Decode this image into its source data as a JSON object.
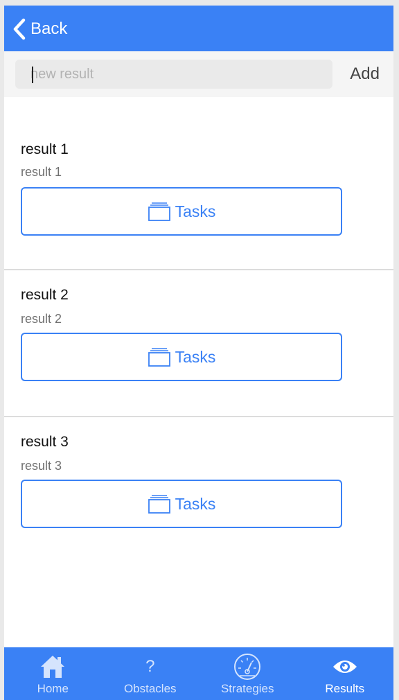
{
  "header": {
    "back_label": "Back"
  },
  "input_bar": {
    "placeholder": "new result",
    "add_label": "Add"
  },
  "results": [
    {
      "title": "result 1",
      "subtitle": "result 1",
      "button_label": "Tasks"
    },
    {
      "title": "result 2",
      "subtitle": "result 2",
      "button_label": "Tasks"
    },
    {
      "title": "result 3",
      "subtitle": "result 3",
      "button_label": "Tasks"
    }
  ],
  "tabs": [
    {
      "label": "Home",
      "icon": "home-icon"
    },
    {
      "label": "Obstacles",
      "icon": "question-icon"
    },
    {
      "label": "Strategies",
      "icon": "speedometer-icon"
    },
    {
      "label": "Results",
      "icon": "eye-icon",
      "active": true
    }
  ],
  "colors": {
    "accent": "#3a81f5",
    "tab_inactive": "#d5e4fd"
  }
}
